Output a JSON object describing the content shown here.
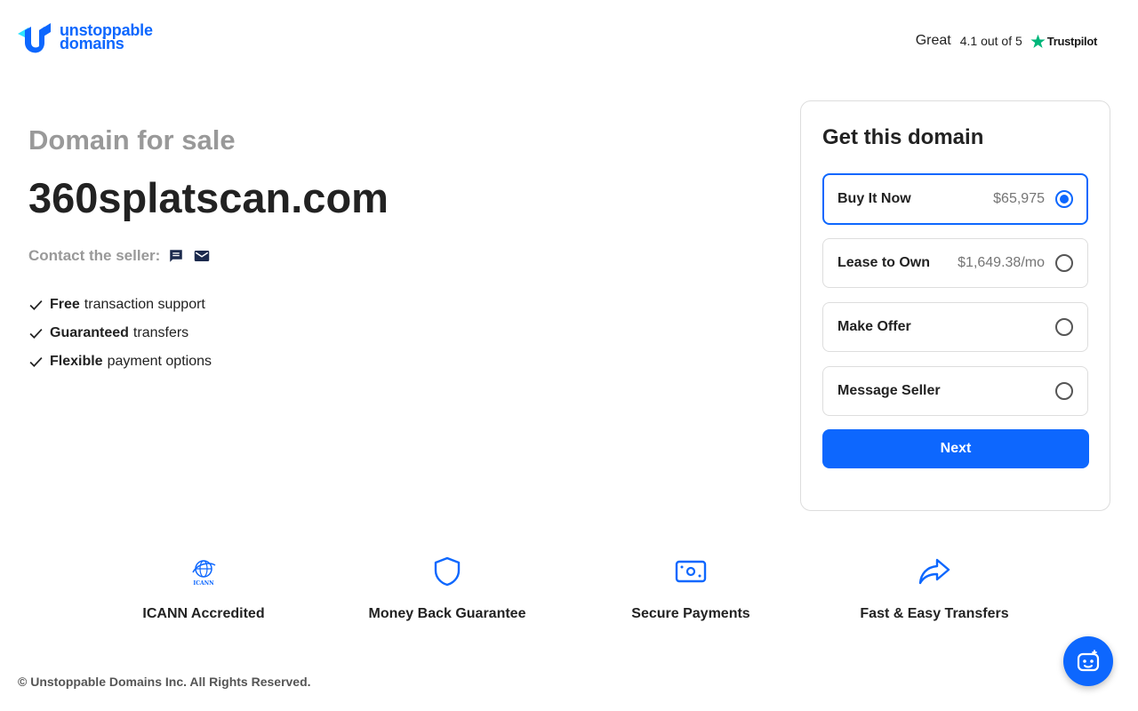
{
  "brand": {
    "line1": "unstoppable",
    "line2": "domains",
    "color": "#0d67fe"
  },
  "trustpilot": {
    "rating_word": "Great",
    "score_text": "4.1 out of 5",
    "brand": "Trustpilot",
    "star_color": "#00b67a",
    "icon": "star-icon"
  },
  "hero": {
    "subtitle": "Domain for sale",
    "domain": "360splatscan.com",
    "contact_label": "Contact the seller:",
    "contact_icons": [
      "chat-icon",
      "mail-icon"
    ],
    "features": [
      {
        "bold": "Free",
        "rest": "transaction support"
      },
      {
        "bold": "Guaranteed",
        "rest": "transfers"
      },
      {
        "bold": "Flexible",
        "rest": "payment options"
      }
    ]
  },
  "purchase": {
    "title": "Get this domain",
    "options": [
      {
        "label": "Buy It Now",
        "price": "$65,975",
        "selected": true
      },
      {
        "label": "Lease to Own",
        "price": "$1,649.38/mo",
        "selected": false
      },
      {
        "label": "Make Offer",
        "price": "",
        "selected": false
      },
      {
        "label": "Message Seller",
        "price": "",
        "selected": false
      }
    ],
    "next_label": "Next"
  },
  "badges": [
    {
      "label": "ICANN Accredited",
      "icon": "icann-globe-icon"
    },
    {
      "label": "Money Back Guarantee",
      "icon": "shield-icon"
    },
    {
      "label": "Secure Payments",
      "icon": "payment-card-icon"
    },
    {
      "label": "Fast & Easy Transfers",
      "icon": "share-arrow-icon"
    }
  ],
  "footer": {
    "copyright": "© Unstoppable Domains Inc. All Rights Reserved."
  },
  "chat": {
    "icon": "chatbot-icon"
  },
  "colors": {
    "primary": "#0d67fe",
    "muted_text": "#999999",
    "border": "#dddddd"
  }
}
